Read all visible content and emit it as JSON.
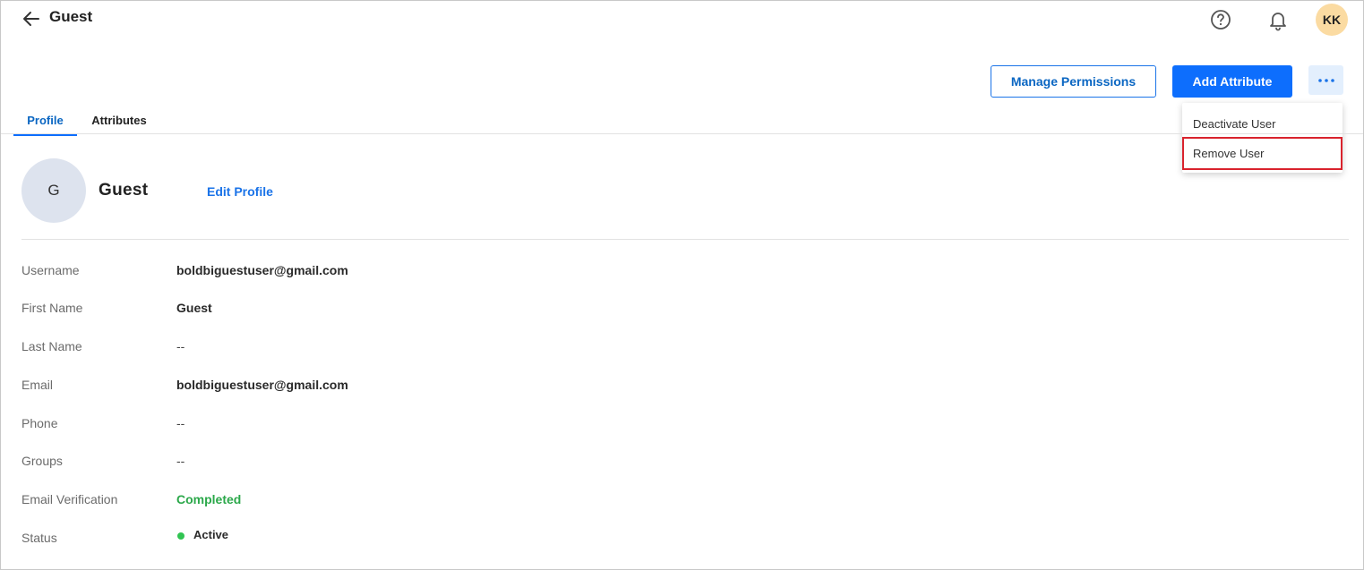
{
  "header": {
    "title": "Guest",
    "avatar_initials": "KK",
    "icons": [
      "back-arrow-icon",
      "help-icon",
      "bell-icon"
    ]
  },
  "toolbar": {
    "manage_permissions_label": "Manage Permissions",
    "add_attribute_label": "Add Attribute",
    "more_icon": "more-horizontal-icon"
  },
  "menu": {
    "items": [
      {
        "label": "Deactivate User"
      },
      {
        "label": "Remove User",
        "highlighted": true
      }
    ]
  },
  "tabs": [
    {
      "label": "Profile",
      "active": true
    },
    {
      "label": "Attributes",
      "active": false
    }
  ],
  "profile": {
    "avatar_letter": "G",
    "name": "Guest",
    "edit_label": "Edit Profile"
  },
  "fields": [
    {
      "label": "Username",
      "value": "boldbiguestuser@gmail.com"
    },
    {
      "label": "First Name",
      "value": "Guest"
    },
    {
      "label": "Last Name",
      "value": "--"
    },
    {
      "label": "Email",
      "value": "boldbiguestuser@gmail.com"
    },
    {
      "label": "Phone",
      "value": "--"
    },
    {
      "label": "Groups",
      "value": "--"
    },
    {
      "label": "Email Verification",
      "value": "Completed"
    },
    {
      "label": "Status",
      "value": "Active"
    }
  ],
  "colors": {
    "primary": "#0d6efd",
    "link": "#1a73e8",
    "success": "#2ba84a",
    "status_active": "#31c452",
    "highlight_border": "#d9232d",
    "avatar_top_bg": "#fbdba2",
    "profile_avatar_bg": "#dde3ee"
  }
}
